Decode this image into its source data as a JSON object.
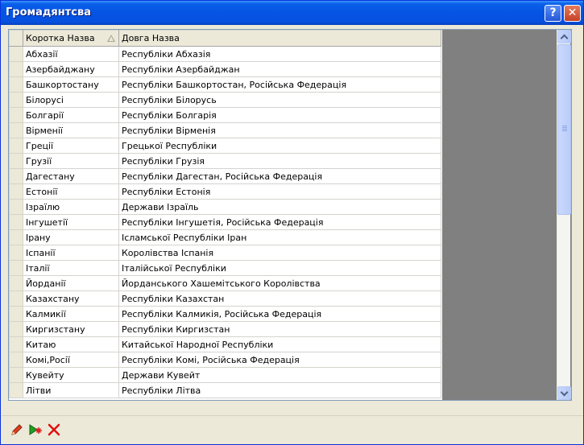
{
  "window": {
    "title": "Громадянтсва",
    "help_label": "?",
    "close_label": "✕"
  },
  "grid": {
    "columns": [
      "Коротка Назва",
      "Довга Назва"
    ],
    "sorted_column": "Коротка Назва",
    "rows": [
      [
        "Абхазії",
        "Республіки Абхазія"
      ],
      [
        "Азербайджану",
        "Республіки Азербайджан"
      ],
      [
        "Башкортостану",
        "Республіки Башкортостан, Російська Федерація"
      ],
      [
        "Білорусі",
        "Республіки Білорусь"
      ],
      [
        "Болгарії",
        "Республіки Болгарія"
      ],
      [
        "Вірменії",
        "Республіки Вірменія"
      ],
      [
        "Греції",
        "Грецької Республіки"
      ],
      [
        "Грузії",
        "Республіки Грузія"
      ],
      [
        "Дагестану",
        "Республіки Дагестан, Російська Федерація"
      ],
      [
        "Естонії",
        "Республіки Естонія"
      ],
      [
        "Ізраїлю",
        "Держави Ізраїль"
      ],
      [
        "Інгушетії",
        "Республіки Інгушетія, Російська Федерація"
      ],
      [
        "Ірану",
        "Ісламської Республіки Іран"
      ],
      [
        "Іспанії",
        "Королівства Іспанія"
      ],
      [
        "Італії",
        "Італійської Республіки"
      ],
      [
        "Йорданії",
        "Йорданського Хашемітського Королівства"
      ],
      [
        "Казахстану",
        "Республіки Казахстан"
      ],
      [
        "Калмикії",
        "Республіки Калмикія, Російська Федерація"
      ],
      [
        "Киргизстану",
        "Республіки Киргизстан"
      ],
      [
        "Китаю",
        "Китайської Народної Республіки"
      ],
      [
        "Комі,Росії",
        "Республіки Комі, Російська Федерація"
      ],
      [
        "Кувейту",
        "Держави Кувейт"
      ],
      [
        "Літви",
        "Республіки Літва"
      ]
    ]
  },
  "toolbar": {
    "edit_icon": "pencil-icon",
    "add_icon": "play-add-icon",
    "delete_icon": "red-x-icon"
  },
  "colors": {
    "titlebar": "#0554E3",
    "grid_background": "#808080",
    "window_face": "#ECE9D8"
  }
}
